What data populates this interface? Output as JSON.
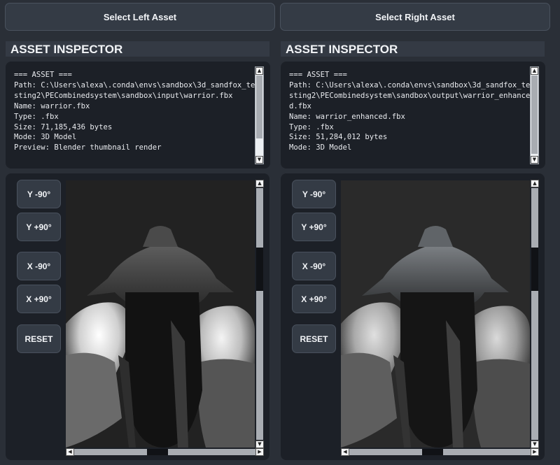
{
  "left": {
    "select_label": "Select Left Asset",
    "inspector_title": "ASSET INSPECTOR",
    "info": "=== ASSET ===\nPath: C:\\Users\\alexa\\.conda\\envs\\sandbox\\3d_sandfox_testing2\\PECombinedsystem\\sandbox\\input\\warrior.fbx\nName: warrior.fbx\nType: .fbx\nSize: 71,185,436 bytes\nMode: 3D Model\nPreview: Blender thumbnail render",
    "rotate": {
      "y_minus": "Y -90°",
      "y_plus": "Y +90°",
      "x_minus": "X -90°",
      "x_plus": "X +90°",
      "reset": "RESET"
    }
  },
  "right": {
    "select_label": "Select Right Asset",
    "inspector_title": "ASSET INSPECTOR",
    "info": "=== ASSET ===\nPath: C:\\Users\\alexa\\.conda\\envs\\sandbox\\3d_sandfox_testing2\\PECombinedsystem\\sandbox\\output\\warrior_enhanced.fbx\nName: warrior_enhanced.fbx\nType: .fbx\nSize: 51,284,012 bytes\nMode: 3D Model",
    "rotate": {
      "y_minus": "Y -90°",
      "y_plus": "Y +90°",
      "x_minus": "X -90°",
      "x_plus": "X +90°",
      "reset": "RESET"
    }
  },
  "icons": {
    "scroll_up": "▲",
    "scroll_down": "▼",
    "scroll_left": "◀",
    "scroll_right": "▶"
  },
  "colors": {
    "background": "#2a2f37",
    "button": "#343b45",
    "panel": "#1c2027",
    "text": "#f2f4f7"
  }
}
